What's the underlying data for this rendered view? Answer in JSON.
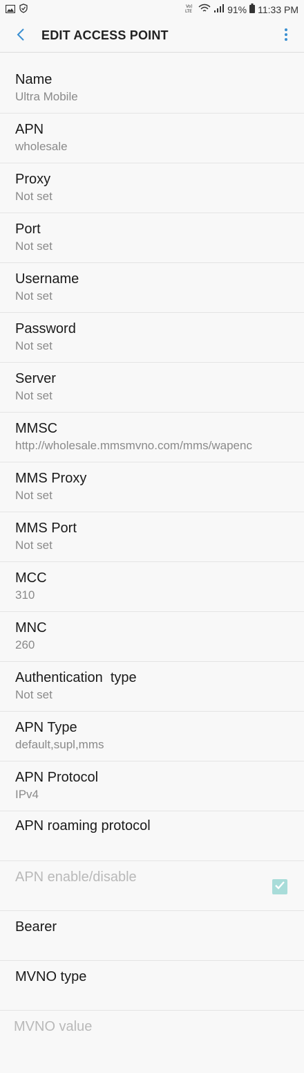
{
  "status_bar": {
    "left_icons": [
      "gallery-icon",
      "shield-icon"
    ],
    "right_icons": [
      "volte-icon",
      "wifi-icon",
      "signal-icon",
      "battery-icon"
    ],
    "battery": "91%",
    "time": "11:33 PM"
  },
  "app_bar": {
    "title": "EDIT ACCESS POINT",
    "back_icon": "chevron-left-icon",
    "more_icon": "more-vert-icon",
    "accent_color": "#3a8fd1"
  },
  "fields": {
    "name": {
      "label": "Name",
      "value": "Ultra Mobile"
    },
    "apn": {
      "label": "APN",
      "value": "wholesale"
    },
    "proxy": {
      "label": "Proxy",
      "value": "Not set"
    },
    "port": {
      "label": "Port",
      "value": "Not set"
    },
    "username": {
      "label": "Username",
      "value": "Not set"
    },
    "password": {
      "label": "Password",
      "value": "Not set"
    },
    "server": {
      "label": "Server",
      "value": "Not set"
    },
    "mmsc": {
      "label": "MMSC",
      "value": "http://wholesale.mmsmvno.com/mms/wapenc"
    },
    "mms_proxy": {
      "label": "MMS Proxy",
      "value": "Not set"
    },
    "mms_port": {
      "label": "MMS Port",
      "value": "Not set"
    },
    "mcc": {
      "label": "MCC",
      "value": "310"
    },
    "mnc": {
      "label": "MNC",
      "value": "260"
    },
    "auth_type": {
      "label": "Authentication  type",
      "value": "Not set"
    },
    "apn_type": {
      "label": "APN Type",
      "value": "default,supl,mms"
    },
    "apn_protocol": {
      "label": "APN Protocol",
      "value": "IPv4"
    },
    "apn_roaming_protocol": {
      "label": "APN roaming protocol"
    },
    "apn_enable": {
      "label": "APN enable/disable",
      "checked": true
    },
    "bearer": {
      "label": "Bearer"
    },
    "mvno_type": {
      "label": "MVNO type"
    },
    "mvno_value": {
      "label": "MVNO value"
    }
  }
}
